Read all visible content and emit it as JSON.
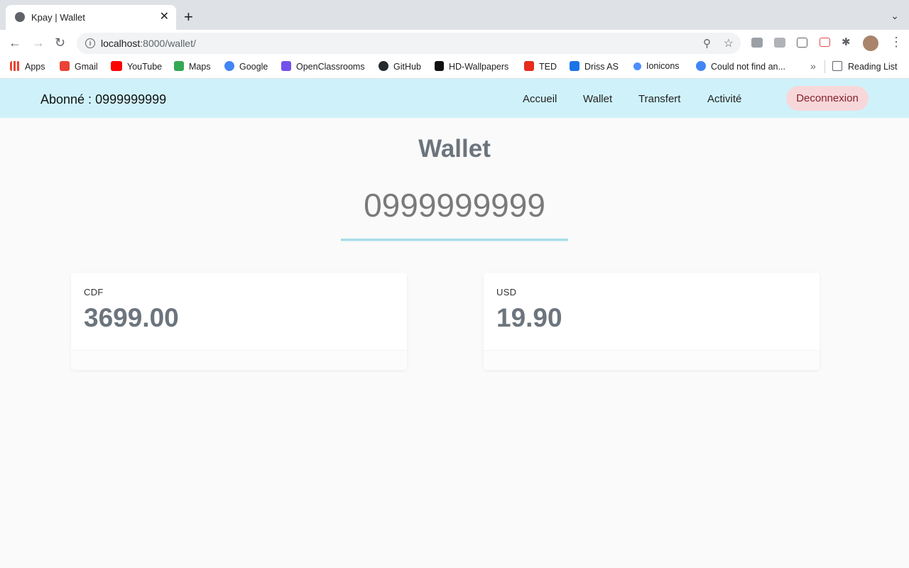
{
  "browser": {
    "tab_title": "Kpay | Wallet",
    "tab_close": "✕",
    "new_tab": "+",
    "url_host": "localhost",
    "url_path": ":8000/wallet/",
    "bookmarks": [
      "Apps",
      "Gmail",
      "YouTube",
      "Maps",
      "Google",
      "OpenClassrooms",
      "GitHub",
      "HD-Wallpapers",
      "TED",
      "Driss AS",
      "Ionicons",
      "Could not find an..."
    ],
    "overflow": "»",
    "reading_list": "Reading List"
  },
  "nav": {
    "subscriber": "Abonné : 0999999999",
    "links": [
      "Accueil",
      "Wallet",
      "Transfert",
      "Activité"
    ],
    "logout": "Deconnexion"
  },
  "main": {
    "title": "Wallet",
    "number": "0999999999",
    "cards": [
      {
        "currency": "CDF",
        "amount": "3699.00"
      },
      {
        "currency": "USD",
        "amount": "19.90"
      }
    ]
  },
  "colors": {
    "nav_bg": "#cff2fa",
    "logout_bg": "#f8d7da",
    "logout_text": "#842029",
    "heading": "#6c757d"
  }
}
